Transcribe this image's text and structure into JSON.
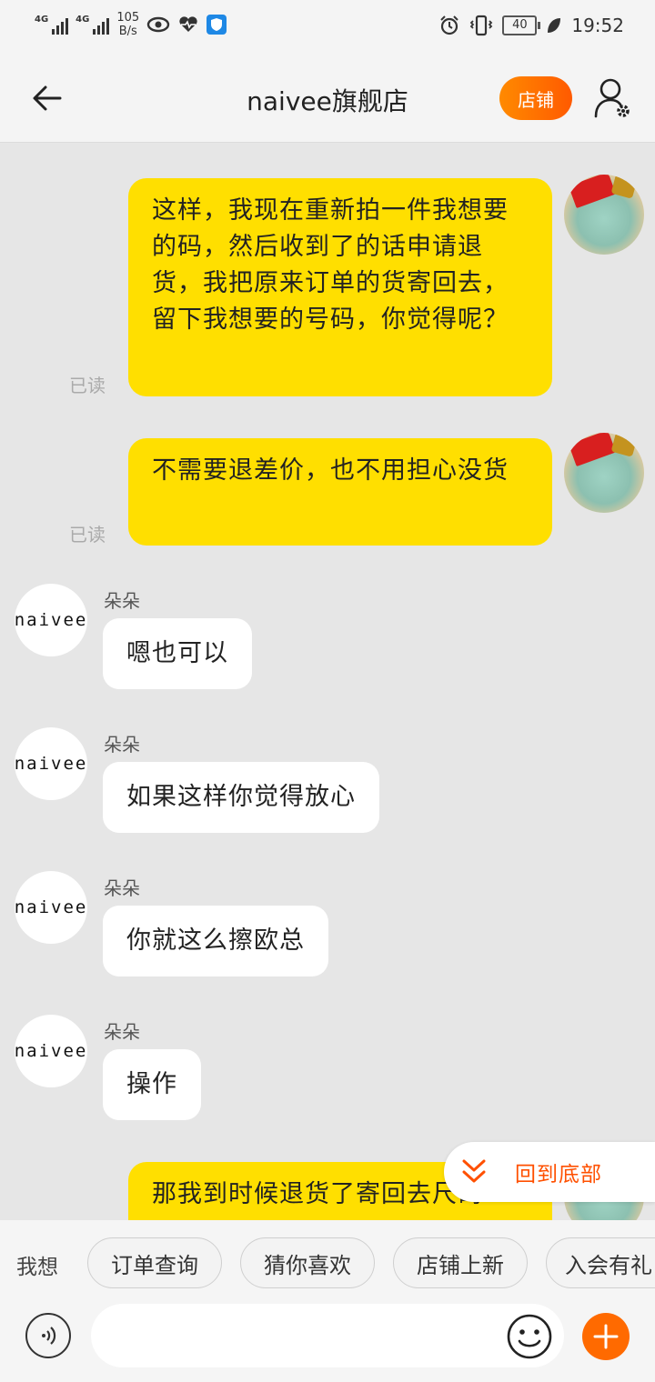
{
  "status_bar": {
    "network_1": "4G",
    "network_2": "4G",
    "speed_value": "105",
    "speed_unit": "B/s",
    "battery": "40",
    "time": "19:52"
  },
  "header": {
    "title": "naivee旗舰店",
    "shop_button": "店铺"
  },
  "messages": {
    "m1": {
      "text": "这样，我现在重新拍一件我想要的码，然后收到了的话申请退货，我把原来订单的货寄回去，留下我想要的号码，你觉得呢？",
      "status": "已读"
    },
    "m2": {
      "text": "不需要退差价，也不用担心没货",
      "status": "已读"
    },
    "m3": {
      "sender": "朵朵",
      "avatar_text": "naivee",
      "text": "嗯也可以"
    },
    "m4": {
      "sender": "朵朵",
      "avatar_text": "naivee",
      "text": "如果这样你觉得放心"
    },
    "m5": {
      "sender": "朵朵",
      "avatar_text": "naivee",
      "text": "你就这么擦欧总"
    },
    "m6": {
      "sender": "朵朵",
      "avatar_text": "naivee",
      "text": "操作"
    },
    "m7": {
      "text": "那我到时候退货了寄回去尺码"
    }
  },
  "back_to_bottom": "回到底部",
  "quick": {
    "label": "我想",
    "chips": [
      "订单查询",
      "猜你喜欢",
      "店铺上新",
      "入会有礼"
    ]
  },
  "input": {
    "placeholder": ""
  },
  "colors": {
    "my_bubble": "#ffdf00",
    "accent": "#ff5000",
    "background": "#e6e6e6"
  }
}
